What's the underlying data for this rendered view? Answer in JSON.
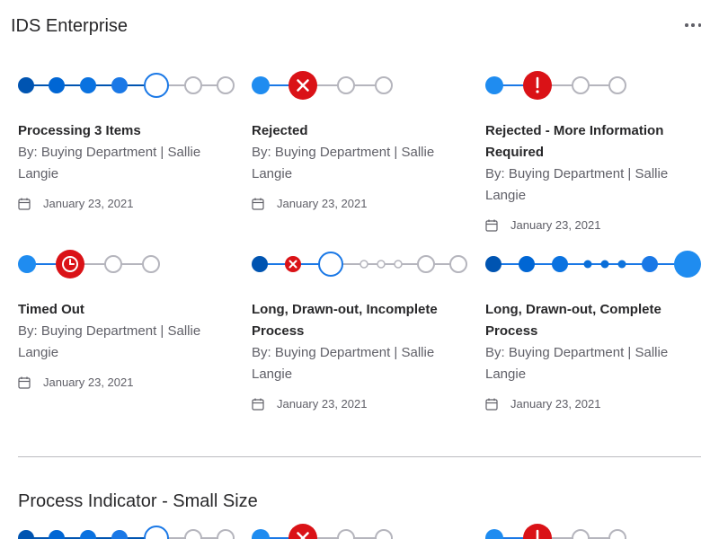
{
  "app": {
    "title": "IDS Enterprise"
  },
  "icons": {
    "more": "more-horizontal-icon",
    "calendar": "calendar-icon",
    "error": "error-icon",
    "alert": "alert-icon",
    "clock": "clock-icon"
  },
  "colors": {
    "primary": "#0054b1",
    "active": "#1a78e6",
    "bright": "#1f8cf0",
    "error": "#da1217",
    "inactive": "#b5b5bd"
  },
  "cards": [
    {
      "title": "Processing 3 Items",
      "meta": "By: Buying Department | Sallie Langie",
      "date": "January 23, 2021"
    },
    {
      "title": "Rejected",
      "meta": "By: Buying Department | Sallie Langie",
      "date": "January 23, 2021"
    },
    {
      "title": "Rejected - More Information Required",
      "meta": "By: Buying Department | Sallie Langie",
      "date": "January 23, 2021"
    },
    {
      "title": "Timed Out",
      "meta": "By: Buying Department | Sallie Langie",
      "date": "January 23, 2021"
    },
    {
      "title": "Long, Drawn-out, Incomplete Process",
      "meta": "By: Buying Department | Sallie Langie",
      "date": "January 23, 2021"
    },
    {
      "title": "Long, Drawn-out, Complete Process",
      "meta": "By: Buying Department | Sallie Langie",
      "date": "January 23, 2021"
    }
  ],
  "section": {
    "title": "Process Indicator - Small Size"
  }
}
